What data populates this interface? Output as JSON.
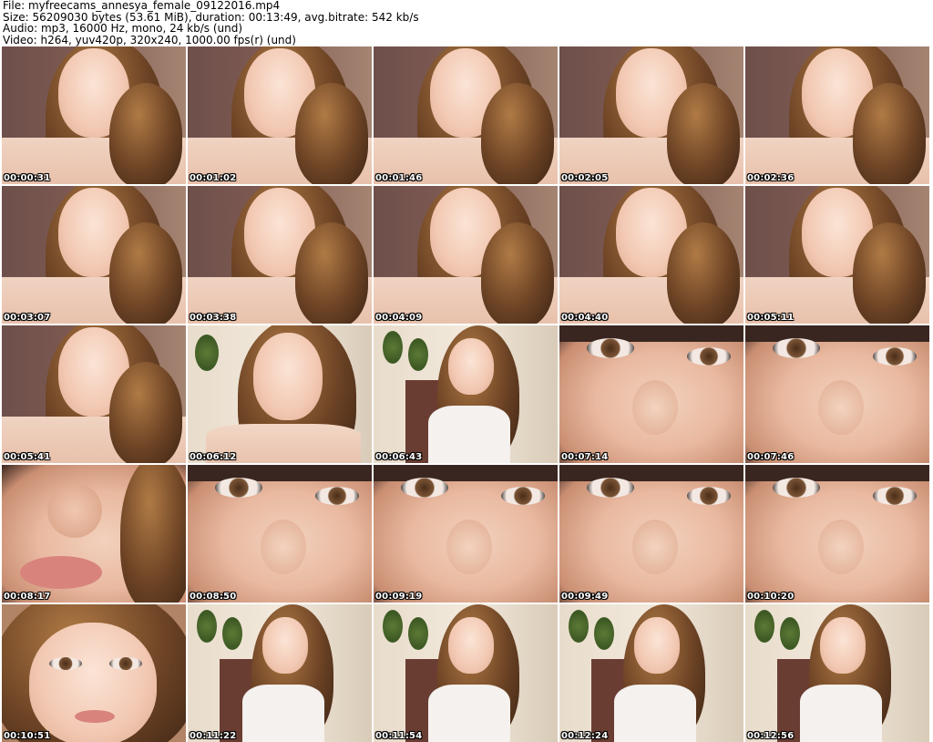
{
  "header": {
    "file_line": "File: myfreecams_annesya_female_09122016.mp4",
    "size_line": "Size: 56209030 bytes (53.61 MiB), duration: 00:13:49, avg.bitrate: 542 kb/s",
    "audio_line": "Audio: mp3, 16000 Hz, mono, 24 kb/s (und)",
    "video_line": "Video: h264, yuv420p, 320x240, 1000.00 fps(r) (und)"
  },
  "thumbnails": [
    {
      "timestamp": "00:00:31",
      "scene": "room-portrait"
    },
    {
      "timestamp": "00:01:02",
      "scene": "room-portrait"
    },
    {
      "timestamp": "00:01:46",
      "scene": "room-portrait"
    },
    {
      "timestamp": "00:02:05",
      "scene": "room-portrait"
    },
    {
      "timestamp": "00:02:36",
      "scene": "room-portrait"
    },
    {
      "timestamp": "00:03:07",
      "scene": "room-portrait"
    },
    {
      "timestamp": "00:03:38",
      "scene": "room-portrait"
    },
    {
      "timestamp": "00:04:09",
      "scene": "room-portrait"
    },
    {
      "timestamp": "00:04:40",
      "scene": "room-portrait"
    },
    {
      "timestamp": "00:05:11",
      "scene": "room-portrait"
    },
    {
      "timestamp": "00:05:41",
      "scene": "room-portrait"
    },
    {
      "timestamp": "00:06:12",
      "scene": "wood-portrait"
    },
    {
      "timestamp": "00:06:43",
      "scene": "wood-wide"
    },
    {
      "timestamp": "00:07:14",
      "scene": "eyes-closeup"
    },
    {
      "timestamp": "00:07:46",
      "scene": "eyes-closeup"
    },
    {
      "timestamp": "00:08:17",
      "scene": "lips-closeup"
    },
    {
      "timestamp": "00:08:50",
      "scene": "eyes-closeup"
    },
    {
      "timestamp": "00:09:19",
      "scene": "eyes-closeup"
    },
    {
      "timestamp": "00:09:49",
      "scene": "eyes-closeup"
    },
    {
      "timestamp": "00:10:20",
      "scene": "eyes-closeup"
    },
    {
      "timestamp": "00:10:51",
      "scene": "face-closeup"
    },
    {
      "timestamp": "00:11:22",
      "scene": "wood-wide"
    },
    {
      "timestamp": "00:11:54",
      "scene": "wood-wide"
    },
    {
      "timestamp": "00:12:24",
      "scene": "wood-wide"
    },
    {
      "timestamp": "00:12:56",
      "scene": "wood-wide"
    }
  ]
}
